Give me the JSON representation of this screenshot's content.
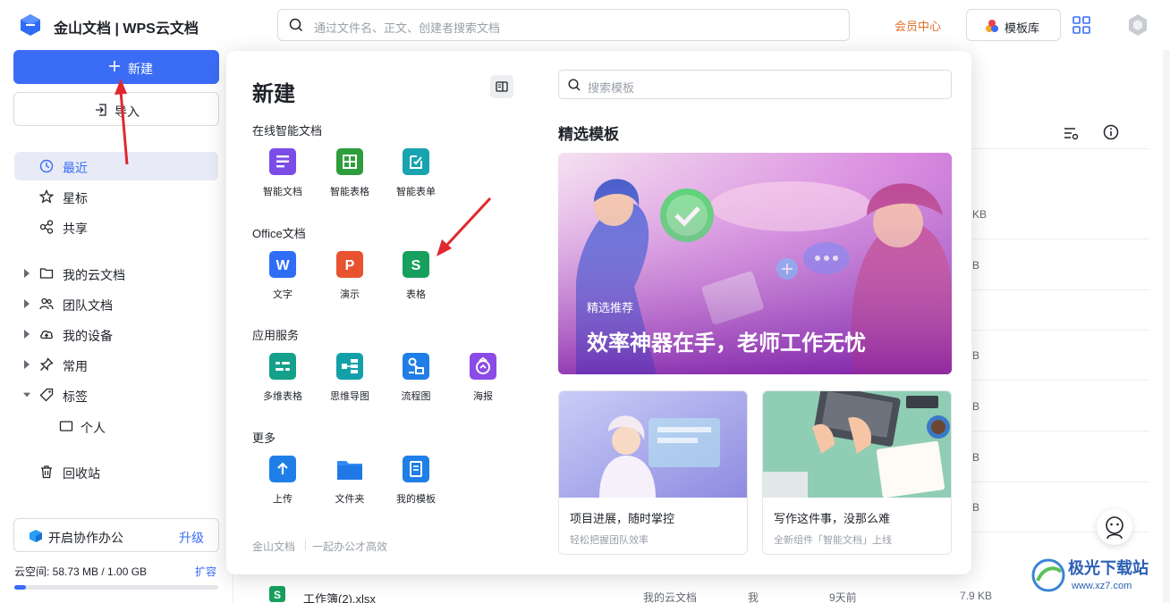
{
  "app": {
    "title": "金山文档 | WPS云文档"
  },
  "header": {
    "search_placeholder": "通过文件名、正文、创建者搜索文档",
    "member_center": "会员中心",
    "template_library": "模板库"
  },
  "sidebar": {
    "new_label": "新建",
    "import_label": "导入",
    "items": [
      {
        "label": "最近",
        "icon": "clock-icon"
      },
      {
        "label": "星标",
        "icon": "star-icon"
      },
      {
        "label": "共享",
        "icon": "share-icon"
      },
      {
        "label": "我的云文档",
        "icon": "folder-icon"
      },
      {
        "label": "团队文档",
        "icon": "team-icon"
      },
      {
        "label": "我的设备",
        "icon": "cloud-device-icon"
      },
      {
        "label": "常用",
        "icon": "pin-icon"
      },
      {
        "label": "标签",
        "icon": "tag-icon"
      },
      {
        "label": "个人",
        "icon": "label-icon"
      },
      {
        "label": "回收站",
        "icon": "trash-icon"
      }
    ],
    "collab_label": "开启协作办公",
    "upgrade_label": "升级",
    "storage_text": "云空间: 58.73 MB / 1.00 GB",
    "expand_label": "扩容",
    "storage_used_fraction": 0.057
  },
  "file_list": {
    "partial_sizes": [
      "KB",
      "B",
      "B",
      "B",
      "B",
      "B"
    ],
    "bottom_row": {
      "name": "工作簿(2).xlsx",
      "location": "我的云文档",
      "owner": "我",
      "time": "9天前",
      "size": "7.9 KB"
    }
  },
  "new_panel": {
    "title": "新建",
    "sections": [
      {
        "title": "在线智能文档",
        "items": [
          "智能文档",
          "智能表格",
          "智能表单"
        ]
      },
      {
        "title": "Office文档",
        "items": [
          "文字",
          "演示",
          "表格"
        ]
      },
      {
        "title": "应用服务",
        "items": [
          "多维表格",
          "思维导图",
          "流程图",
          "海报"
        ]
      },
      {
        "title": "更多",
        "items": [
          "上传",
          "文件夹",
          "我的模板"
        ]
      }
    ],
    "footer_brand": "金山文档",
    "footer_slogan": "一起办公才高效",
    "template_search_placeholder": "搜索模板",
    "templates_heading": "精选模板",
    "banner_tag": "精选推荐",
    "banner_headline": "效率神器在手，老师工作无忧",
    "cards": [
      {
        "title": "项目进展，随时掌控",
        "subtitle": "轻松把握团队效率"
      },
      {
        "title": "写作这件事，没那么难",
        "subtitle": "全新组件「智能文档」上线"
      }
    ]
  },
  "watermark": {
    "name": "极光下载站",
    "url": "www.xz7.com"
  },
  "colors": {
    "accent": "#3b6cf6",
    "member": "#e2702c"
  }
}
